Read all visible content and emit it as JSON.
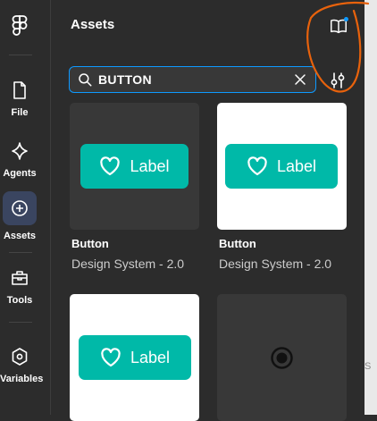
{
  "rail": {
    "items": [
      {
        "label": "File",
        "icon": "file-icon"
      },
      {
        "label": "Agents",
        "icon": "sparkle-icon"
      },
      {
        "label": "Assets",
        "icon": "assets-icon"
      },
      {
        "label": "Tools",
        "icon": "toolbox-icon"
      },
      {
        "label": "Variables",
        "icon": "hexagon-icon"
      }
    ],
    "active": "Assets"
  },
  "panel": {
    "title": "Assets"
  },
  "search": {
    "value": "BUTTON"
  },
  "cards": [
    {
      "name": "Button",
      "subtitle": "Design System - 2.0",
      "preview_label": "Label",
      "theme": "dark"
    },
    {
      "name": "Button",
      "subtitle": "Design System - 2.0",
      "preview_label": "Label",
      "theme": "light"
    },
    {
      "preview_label": "Label",
      "theme": "light"
    },
    {
      "theme": "dark",
      "preview": "radio-icon"
    }
  ],
  "colors": {
    "accent": "#0d99ff",
    "button_teal": "#00b9a8",
    "annotation": "#e8620c",
    "panel_bg": "#2c2c2c"
  },
  "scrollbar": {
    "glyph": "S"
  }
}
